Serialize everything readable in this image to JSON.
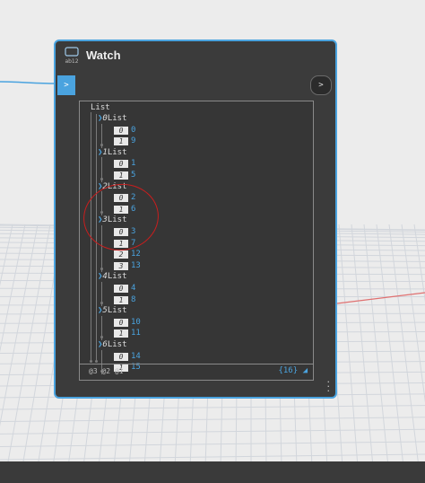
{
  "node": {
    "title": "Watch",
    "icon": "watch-node-icon",
    "input_port": ">",
    "output_port": ">"
  },
  "watch": {
    "root_label": "List",
    "sublists": [
      {
        "index": "0",
        "label": "List",
        "items": [
          {
            "index": "0",
            "value": "0"
          },
          {
            "index": "1",
            "value": "9"
          }
        ]
      },
      {
        "index": "1",
        "label": "List",
        "items": [
          {
            "index": "0",
            "value": "1"
          },
          {
            "index": "1",
            "value": "5"
          }
        ]
      },
      {
        "index": "2",
        "label": "List",
        "items": [
          {
            "index": "0",
            "value": "2"
          },
          {
            "index": "1",
            "value": "6"
          }
        ]
      },
      {
        "index": "3",
        "label": "List",
        "items": [
          {
            "index": "0",
            "value": "3"
          },
          {
            "index": "1",
            "value": "7"
          },
          {
            "index": "2",
            "value": "12"
          },
          {
            "index": "3",
            "value": "13"
          }
        ]
      },
      {
        "index": "4",
        "label": "List",
        "items": [
          {
            "index": "0",
            "value": "4"
          },
          {
            "index": "1",
            "value": "8"
          }
        ]
      },
      {
        "index": "5",
        "label": "List",
        "items": [
          {
            "index": "0",
            "value": "10"
          },
          {
            "index": "1",
            "value": "11"
          }
        ]
      },
      {
        "index": "6",
        "label": "List",
        "items": [
          {
            "index": "0",
            "value": "14"
          },
          {
            "index": "1",
            "value": "15"
          }
        ]
      }
    ],
    "levels": "@3 @2 @1",
    "count": "{16}"
  },
  "colors": {
    "accent": "#4aa3df",
    "node_bg": "#3b3b3b",
    "annotation": "#c81e1e"
  }
}
